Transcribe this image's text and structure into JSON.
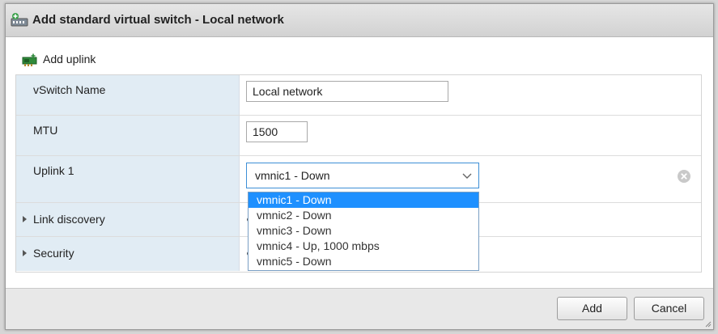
{
  "dialog": {
    "title": "Add standard virtual switch - Local network"
  },
  "toolbar": {
    "add_uplink_label": "Add uplink",
    "add_uplink_icon": "network-card-add-icon"
  },
  "form": {
    "vswitch_name_label": "vSwitch Name",
    "vswitch_name_value": "Local network",
    "mtu_label": "MTU",
    "mtu_value": "1500",
    "uplink1_label": "Uplink 1",
    "uplink1_selected": "vmnic1 - Down",
    "link_discovery_label": "Link discovery",
    "security_label": "Security"
  },
  "uplink_options": [
    {
      "label": "vmnic1 - Down",
      "selected": true
    },
    {
      "label": "vmnic2 - Down",
      "selected": false
    },
    {
      "label": "vmnic3 - Down",
      "selected": false
    },
    {
      "label": "vmnic4 - Up, 1000 mbps",
      "selected": false
    },
    {
      "label": "vmnic5 - Down",
      "selected": false
    }
  ],
  "footer": {
    "add_label": "Add",
    "cancel_label": "Cancel"
  },
  "colors": {
    "label_bg": "#e1ecf4",
    "selected_option": "#1e90ff",
    "focus_border": "#3d8fd6"
  }
}
